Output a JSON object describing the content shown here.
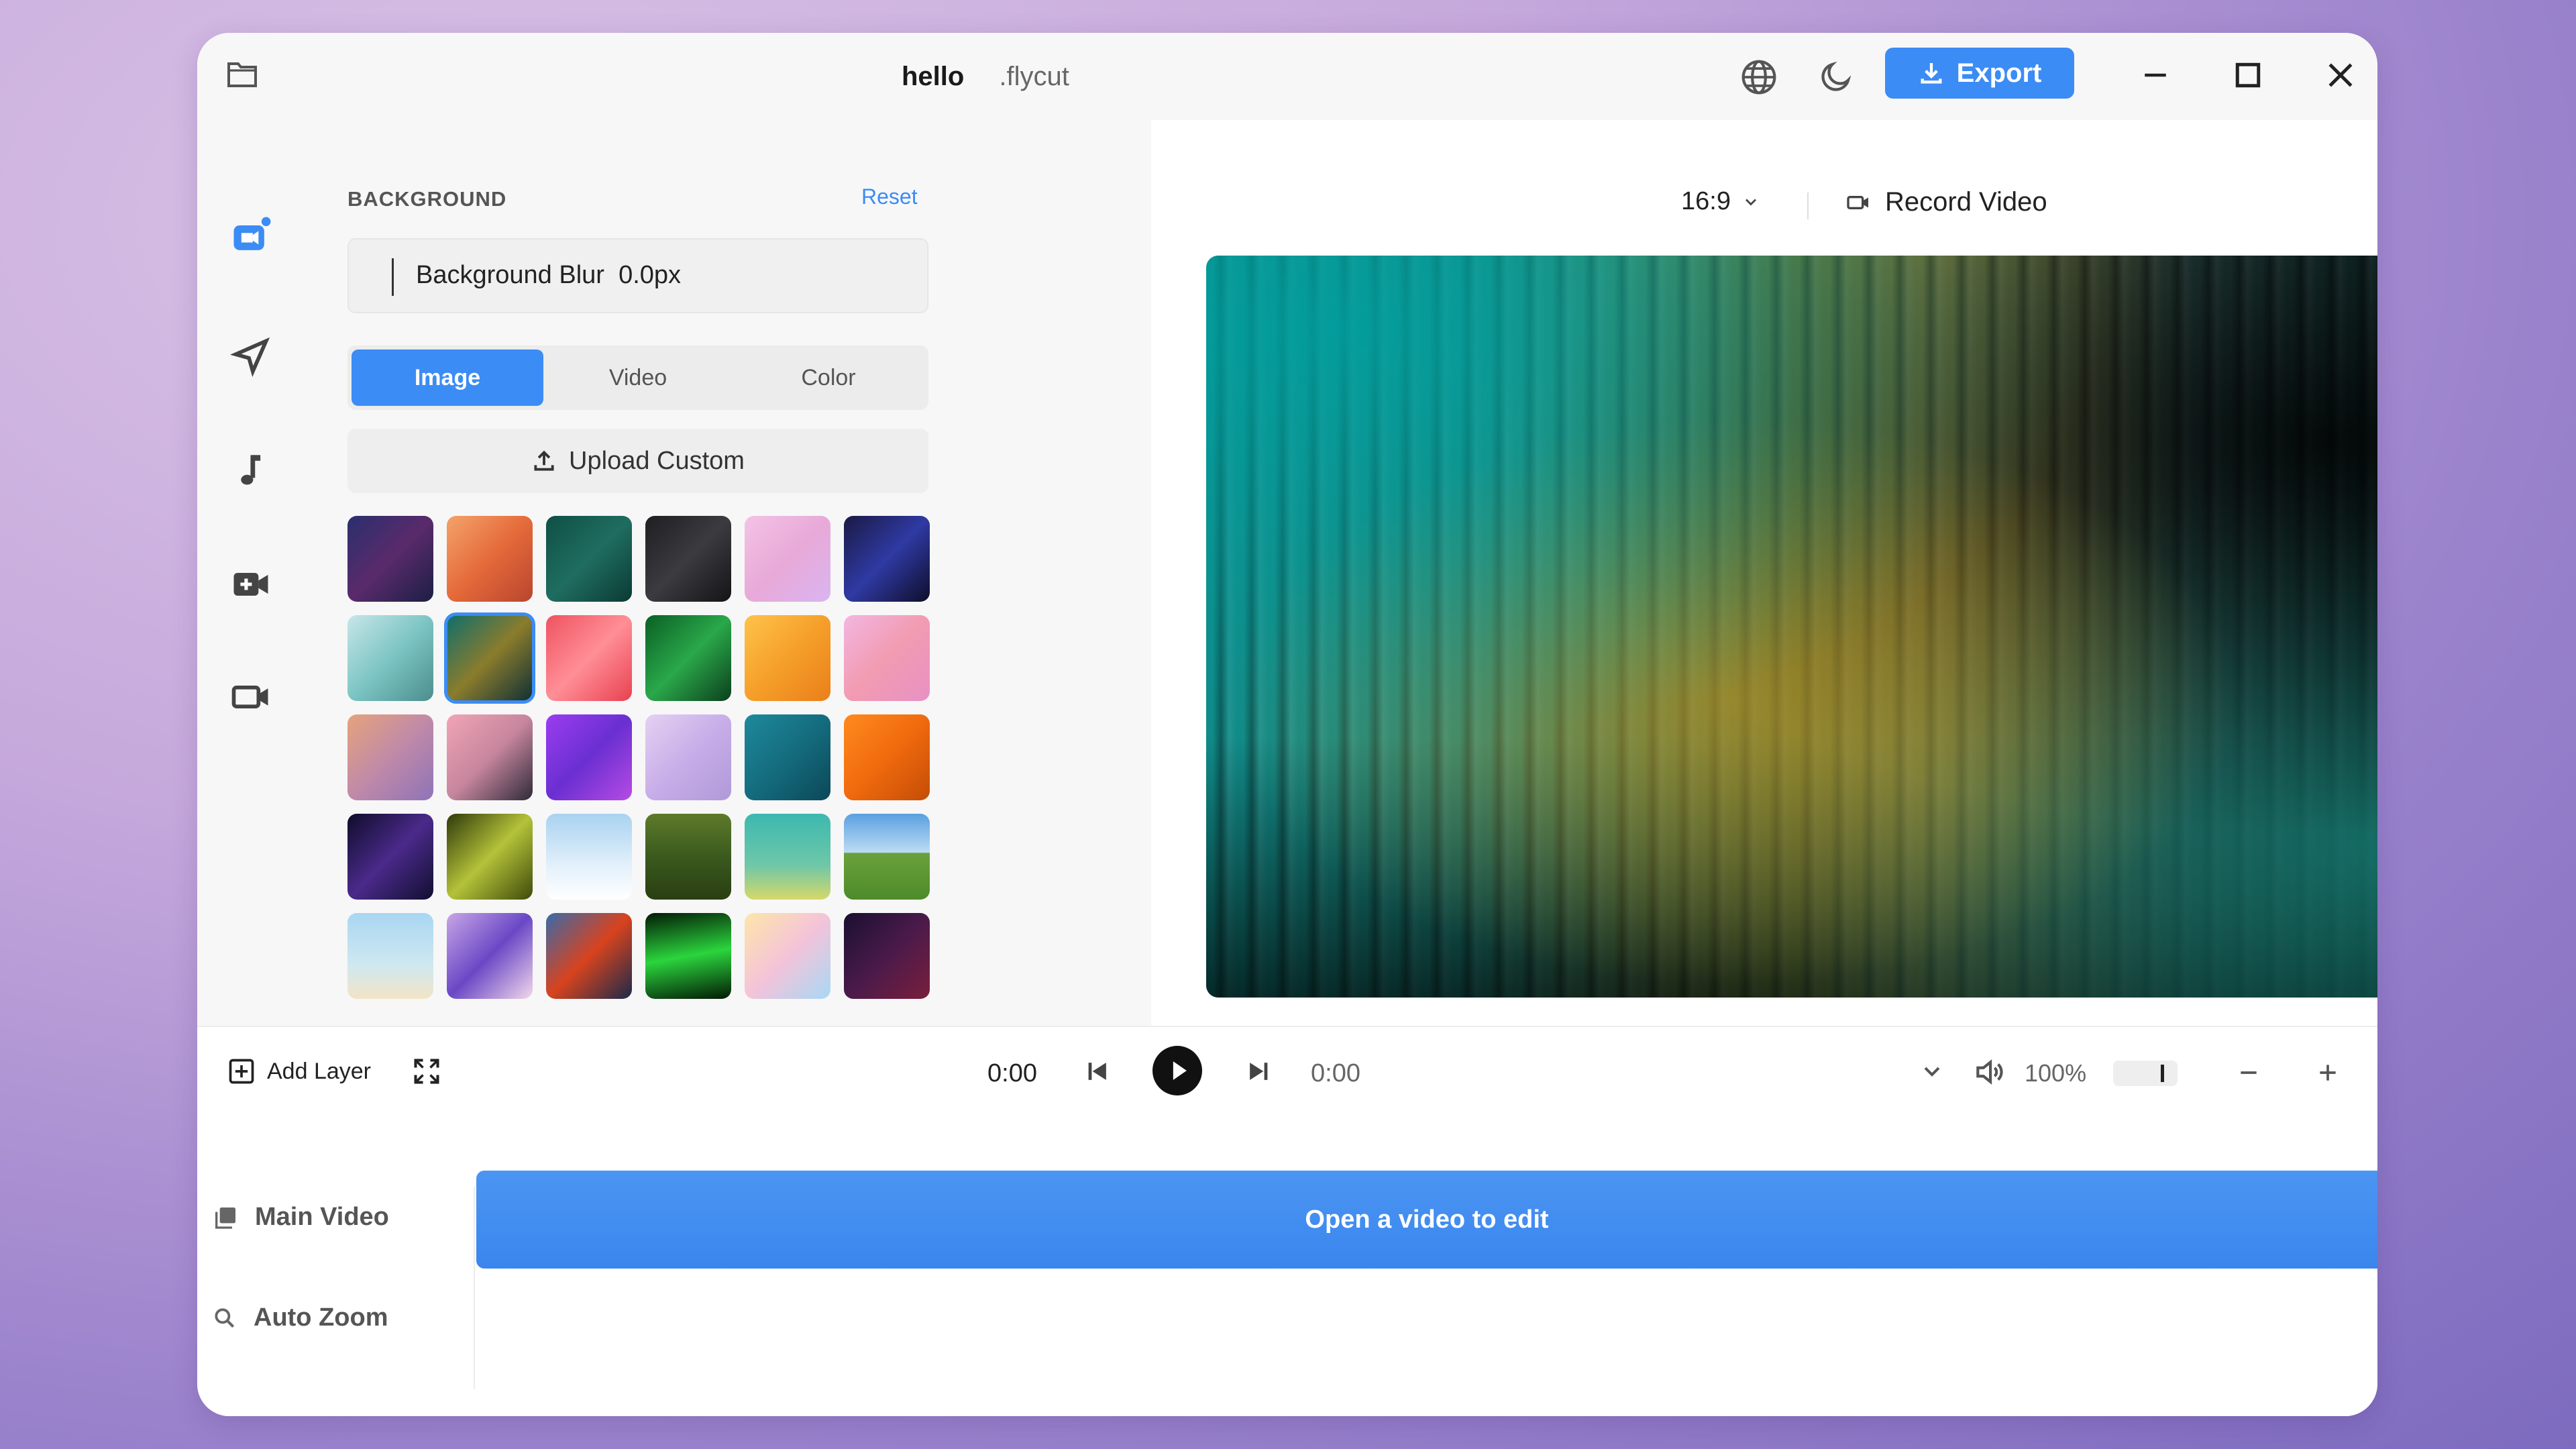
{
  "titlebar": {
    "project_name": "hello",
    "project_ext": ".flycut",
    "export_label": "Export"
  },
  "panel": {
    "section_title": "BACKGROUND",
    "reset_label": "Reset",
    "blur_label": "Background Blur",
    "blur_value": "0.0px",
    "tabs": [
      "Image",
      "Video",
      "Color"
    ],
    "active_tab": "Image",
    "upload_label": "Upload Custom",
    "selected_thumbnail": 7
  },
  "preview": {
    "aspect_ratio": "16:9",
    "record_label": "Record Video"
  },
  "controls": {
    "add_layer_label": "Add Layer",
    "time_current": "0:00",
    "time_total": "0:00",
    "volume_percent": "100%"
  },
  "timeline": {
    "tracks": [
      {
        "label": "Main Video"
      },
      {
        "label": "Auto Zoom"
      }
    ],
    "main_clip_label": "Open a video to edit"
  },
  "colors": {
    "accent": "#3b8cf5",
    "panel_bg": "#f7f7f7"
  }
}
